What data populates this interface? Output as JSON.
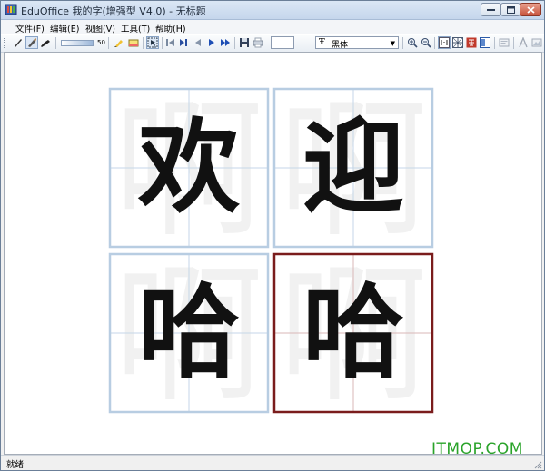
{
  "window": {
    "title": "EduOffice 我的字(增强型 V4.0) - 无标题"
  },
  "menu": {
    "items": [
      "文件(F)",
      "编辑(E)",
      "视图(V)",
      "工具(T)",
      "帮助(H)"
    ]
  },
  "toolbar": {
    "slider_value": "50",
    "page_value": "",
    "font_name": "黑体",
    "font_icon": "Ŧ"
  },
  "grid": {
    "guide_char": "啊",
    "cells": [
      "欢",
      "迎",
      "哈",
      "哈"
    ],
    "selected_cell": 3,
    "colors": {
      "normal_border": "#b8cde2",
      "selected_border": "#7a1c1c",
      "guide_line": "#c5d6e8",
      "selected_guide": "#d9b7b7",
      "guide_char": "#f1f1f1"
    }
  },
  "watermark": "ITMOP.COM",
  "status": {
    "text": "就绪"
  }
}
